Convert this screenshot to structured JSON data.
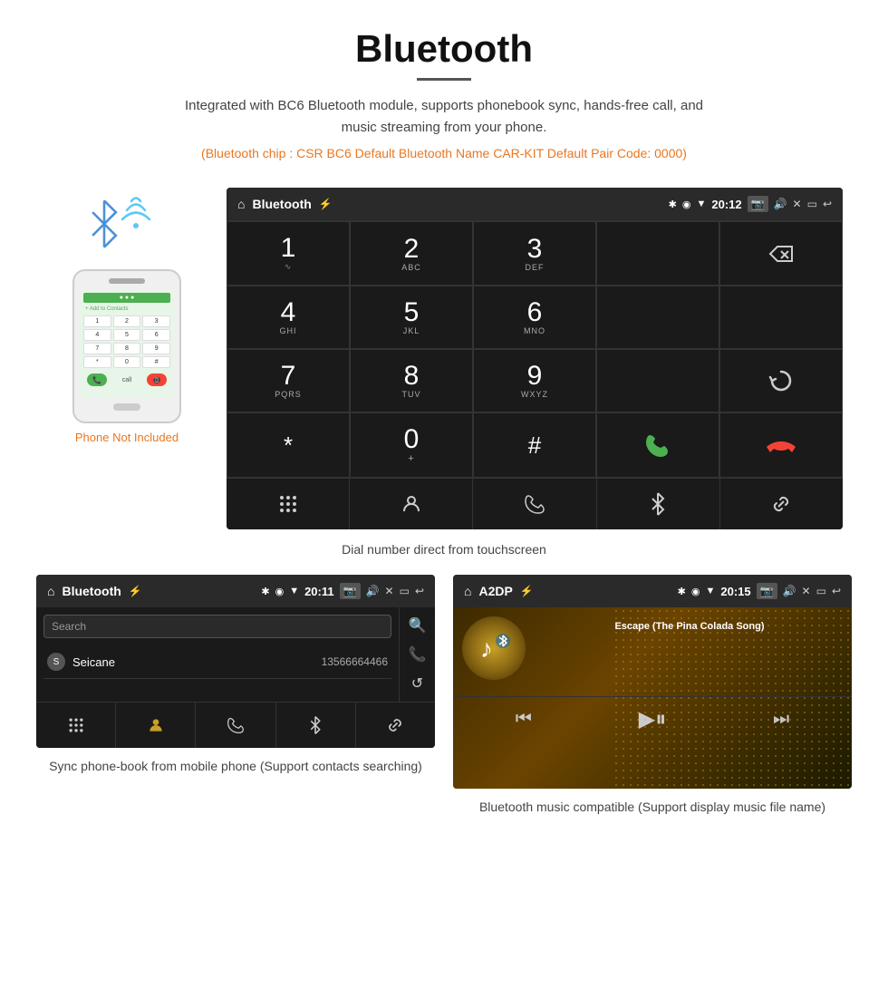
{
  "header": {
    "title": "Bluetooth",
    "description": "Integrated with BC6 Bluetooth module, supports phonebook sync, hands-free call, and music streaming from your phone.",
    "tech_specs": "(Bluetooth chip : CSR BC6    Default Bluetooth Name CAR-KIT    Default Pair Code: 0000)"
  },
  "phone_label": "Phone Not Included",
  "dial_description": "Dial number direct from touchscreen",
  "car_screen": {
    "status_bar": {
      "app_name": "Bluetooth",
      "time": "20:12"
    },
    "dialpad": [
      {
        "number": "1",
        "letters": ""
      },
      {
        "number": "2",
        "letters": "ABC"
      },
      {
        "number": "3",
        "letters": "DEF"
      },
      {
        "number": "",
        "letters": ""
      },
      {
        "number": "⌫",
        "letters": ""
      },
      {
        "number": "4",
        "letters": "GHI"
      },
      {
        "number": "5",
        "letters": "JKL"
      },
      {
        "number": "6",
        "letters": "MNO"
      },
      {
        "number": "",
        "letters": ""
      },
      {
        "number": "",
        "letters": ""
      },
      {
        "number": "7",
        "letters": "PQRS"
      },
      {
        "number": "8",
        "letters": "TUV"
      },
      {
        "number": "9",
        "letters": "WXYZ"
      },
      {
        "number": "",
        "letters": ""
      },
      {
        "number": "↺",
        "letters": ""
      },
      {
        "number": "*",
        "letters": ""
      },
      {
        "number": "0",
        "letters": "+"
      },
      {
        "number": "#",
        "letters": ""
      },
      {
        "number": "📞",
        "letters": ""
      },
      {
        "number": "📵",
        "letters": ""
      }
    ],
    "bottom_nav": [
      "⠿",
      "👤",
      "📞",
      "✱",
      "🔗"
    ]
  },
  "phonebook_screen": {
    "status_app": "Bluetooth",
    "time": "20:11",
    "search_placeholder": "Search",
    "contact": {
      "letter": "S",
      "name": "Seicane",
      "number": "13566664466"
    }
  },
  "music_screen": {
    "status_app": "A2DP",
    "time": "20:15",
    "song_title": "Escape (The Pina Colada Song)"
  },
  "captions": {
    "phonebook": "Sync phone-book from mobile phone\n(Support contacts searching)",
    "music": "Bluetooth music compatible\n(Support display music file name)"
  }
}
